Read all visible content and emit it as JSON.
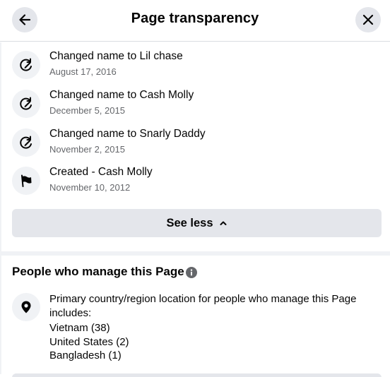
{
  "header": {
    "title": "Page transparency",
    "back_icon": "arrow-left-icon",
    "close_icon": "close-icon"
  },
  "history": [
    {
      "icon": "edit-name-icon",
      "title": "Changed name to Lil chase",
      "date": "August 17, 2016"
    },
    {
      "icon": "edit-name-icon",
      "title": "Changed name to Cash Molly",
      "date": "December 5, 2015"
    },
    {
      "icon": "edit-name-icon",
      "title": "Changed name to Snarly Daddy",
      "date": "November 2, 2015"
    },
    {
      "icon": "flag-icon",
      "title": "Created - Cash Molly",
      "date": "November 10, 2012"
    }
  ],
  "see_less": {
    "label": "See less",
    "icon": "chevron-up-icon"
  },
  "managers": {
    "title": "People who manage this Page",
    "info_icon": "info-icon",
    "location_icon": "location-pin-icon",
    "description": "Primary country/region location for people who manage this Page includes:",
    "countries": [
      "Vietnam (38)",
      "United States (2)",
      "Bangladesh (1)"
    ]
  },
  "colors": {
    "button_bg": "#e4e6eb",
    "icon_bg": "#f0f2f5",
    "secondary_text": "#65676b",
    "primary_text": "#050505"
  }
}
